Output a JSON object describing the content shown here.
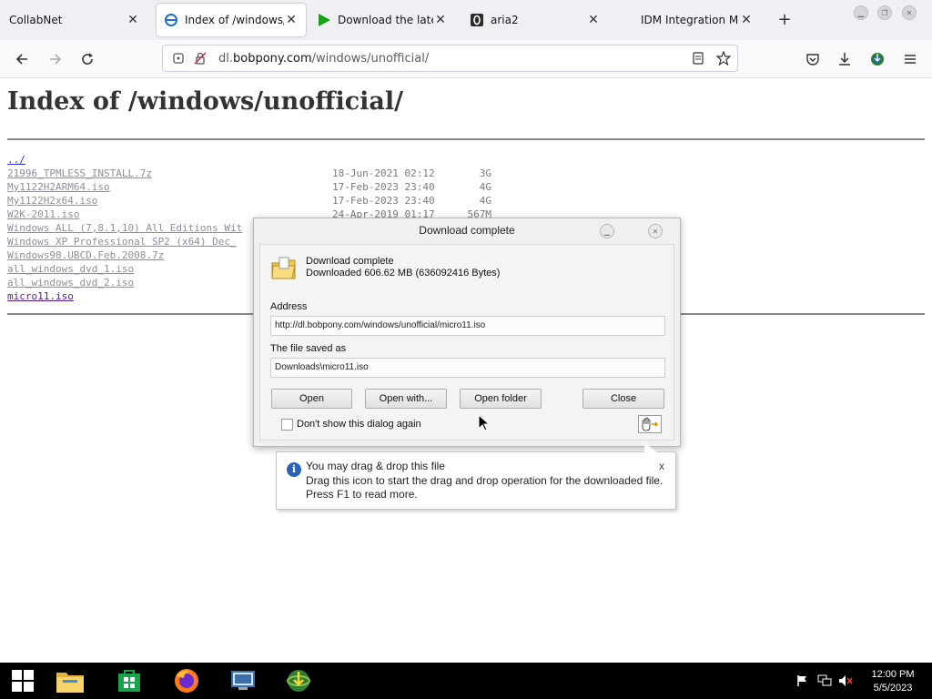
{
  "browser": {
    "tabs": [
      {
        "label": "CollabNet",
        "icon": "none"
      },
      {
        "label": "Index of /windows/u",
        "icon": "ie-page-icon",
        "active": true
      },
      {
        "label": "Download the latest",
        "icon": "green-play-icon"
      },
      {
        "label": "aria2",
        "icon": "aria2-icon"
      },
      {
        "label": "IDM Integration Mod",
        "icon": "none"
      }
    ],
    "url_prefix": "dl.",
    "url_domain": "bobpony.com",
    "url_path": "/windows/unofficial/"
  },
  "page": {
    "heading": "Index of /windows/unofficial/",
    "parent_link": "../",
    "files": [
      {
        "name": "21996_TPMLESS_INSTALL.7z",
        "date": "18-Jun-2021 02:12",
        "size": "3G"
      },
      {
        "name": "My1122H2ARM64.iso",
        "date": "17-Feb-2023 23:40",
        "size": "4G"
      },
      {
        "name": "My1122H2x64.iso",
        "date": "17-Feb-2023 23:40",
        "size": "4G"
      },
      {
        "name": "W2K-2011.iso",
        "date": "24-Apr-2019 01:17",
        "size": "567M"
      },
      {
        "name": "Windows ALL (7,8.1,10) All Editions Wit",
        "date": "",
        "size": ""
      },
      {
        "name": "Windows XP Professional SP2 (x64) Dec_",
        "date": "",
        "size": ""
      },
      {
        "name": "Windows98.UBCD.Feb.2008.7z",
        "date": "",
        "size": ""
      },
      {
        "name": "all_windows_dvd_1.iso",
        "date": "",
        "size": ""
      },
      {
        "name": "all_windows_dvd_2.iso",
        "date": "",
        "size": ""
      },
      {
        "name": "micro11.iso",
        "date": "",
        "size": ""
      }
    ]
  },
  "dialog": {
    "title": "Download complete",
    "status_title": "Download complete",
    "status_detail": "Downloaded 606.62  MB (636092416 Bytes)",
    "address_label": "Address",
    "address_value": "http://dl.bobpony.com/windows/unofficial/micro11.iso",
    "saved_label": "The file saved as",
    "saved_value": "Downloads\\micro11.iso",
    "buttons": {
      "open": "Open",
      "open_with": "Open with...",
      "open_folder": "Open folder",
      "close": "Close"
    },
    "checkbox_label": "Don't show this dialog again"
  },
  "tooltip": {
    "title": "You may drag & drop this file",
    "line1": "Drag this icon to start the drag and drop operation for the downloaded file.",
    "line2": "Press F1 to read more.",
    "close": "x"
  },
  "taskbar": {
    "time": "12:00 PM",
    "date": "5/5/2023"
  },
  "colors": {
    "link_unvisited": "#8e8e9a",
    "link_visited": "#551a8b",
    "info_blue": "#2a64b8"
  }
}
